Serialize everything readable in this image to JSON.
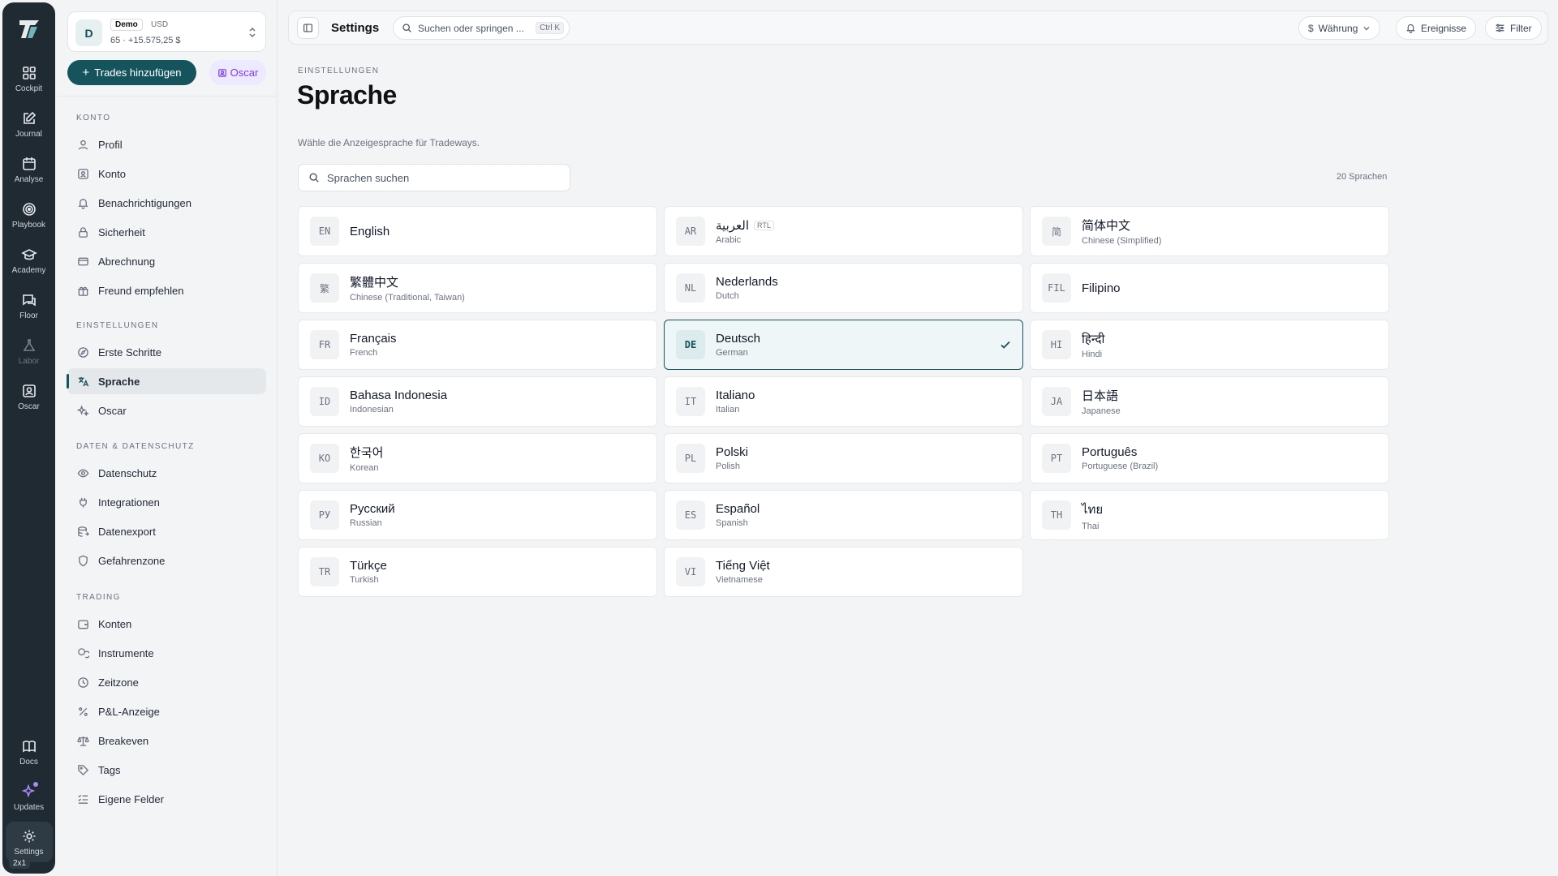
{
  "rail": {
    "items": [
      {
        "label": "Cockpit",
        "icon": "grid-icon"
      },
      {
        "label": "Journal",
        "icon": "edit-icon"
      },
      {
        "label": "Analyse",
        "icon": "calendar-icon"
      },
      {
        "label": "Playbook",
        "icon": "target-icon"
      },
      {
        "label": "Academy",
        "icon": "graduation-icon"
      },
      {
        "label": "Floor",
        "icon": "chat-icon"
      },
      {
        "label": "Labor",
        "icon": "flask-icon"
      },
      {
        "label": "Oscar",
        "icon": "oscar-icon"
      }
    ],
    "bottom": [
      {
        "label": "Docs",
        "icon": "book-icon"
      },
      {
        "label": "Updates",
        "icon": "sparkle-icon"
      },
      {
        "label": "Settings",
        "icon": "gear-icon"
      }
    ],
    "zoom_badge": "2x1"
  },
  "account": {
    "avatar": "D",
    "tag": "Demo",
    "currency": "USD",
    "summary": "65 · +15.575,25 $"
  },
  "sidebar": {
    "add_trades_label": "Trades hinzufügen",
    "oscar_label": "Oscar",
    "sections": [
      {
        "title": "KONTO",
        "items": [
          "Profil",
          "Konto",
          "Benachrichtigungen",
          "Sicherheit",
          "Abrechnung",
          "Freund empfehlen"
        ]
      },
      {
        "title": "EINSTELLUNGEN",
        "items": [
          "Erste Schritte",
          "Sprache",
          "Oscar"
        ]
      },
      {
        "title": "DATEN & DATENSCHUTZ",
        "items": [
          "Datenschutz",
          "Integrationen",
          "Datenexport",
          "Gefahrenzone"
        ]
      },
      {
        "title": "TRADING",
        "items": [
          "Konten",
          "Instrumente",
          "Zeitzone",
          "P&L-Anzeige",
          "Breakeven",
          "Tags",
          "Eigene Felder"
        ]
      }
    ],
    "active_item": "Sprache"
  },
  "topbar": {
    "title": "Settings",
    "search_placeholder": "Suchen oder springen ...",
    "search_shortcut": "Ctrl K",
    "currency_label": "Währung",
    "events_label": "Ereignisse",
    "filter_label": "Filter"
  },
  "main": {
    "breadcrumb": "EINSTELLUNGEN",
    "title": "Sprache",
    "description": "Wähle die Anzeigesprache für Tradeways.",
    "search_placeholder": "Sprachen suchen",
    "count": "20 Sprachen",
    "selected_code": "DE",
    "languages": [
      {
        "code": "EN",
        "native": "English",
        "english": ""
      },
      {
        "code": "AR",
        "native": "العربية",
        "english": "Arabic",
        "badge": "RTL"
      },
      {
        "code": "简",
        "native": "简体中文",
        "english": "Chinese (Simplified)"
      },
      {
        "code": "繁",
        "native": "繁體中文",
        "english": "Chinese (Traditional, Taiwan)"
      },
      {
        "code": "NL",
        "native": "Nederlands",
        "english": "Dutch"
      },
      {
        "code": "FIL",
        "native": "Filipino",
        "english": ""
      },
      {
        "code": "FR",
        "native": "Français",
        "english": "French"
      },
      {
        "code": "DE",
        "native": "Deutsch",
        "english": "German"
      },
      {
        "code": "HI",
        "native": "हिन्दी",
        "english": "Hindi"
      },
      {
        "code": "ID",
        "native": "Bahasa Indonesia",
        "english": "Indonesian"
      },
      {
        "code": "IT",
        "native": "Italiano",
        "english": "Italian"
      },
      {
        "code": "JA",
        "native": "日本語",
        "english": "Japanese"
      },
      {
        "code": "KO",
        "native": "한국어",
        "english": "Korean"
      },
      {
        "code": "PL",
        "native": "Polski",
        "english": "Polish"
      },
      {
        "code": "PT",
        "native": "Português",
        "english": "Portuguese (Brazil)"
      },
      {
        "code": "РУ",
        "native": "Русский",
        "english": "Russian"
      },
      {
        "code": "ES",
        "native": "Español",
        "english": "Spanish"
      },
      {
        "code": "TH",
        "native": "ไทย",
        "english": "Thai"
      },
      {
        "code": "TR",
        "native": "Türkçe",
        "english": "Turkish"
      },
      {
        "code": "VI",
        "native": "Tiếng Việt",
        "english": "Vietnamese"
      }
    ]
  },
  "colors": {
    "accent": "#15545c",
    "rail_bg": "#1f2a32",
    "oscar_purple": "#7c3aed"
  }
}
